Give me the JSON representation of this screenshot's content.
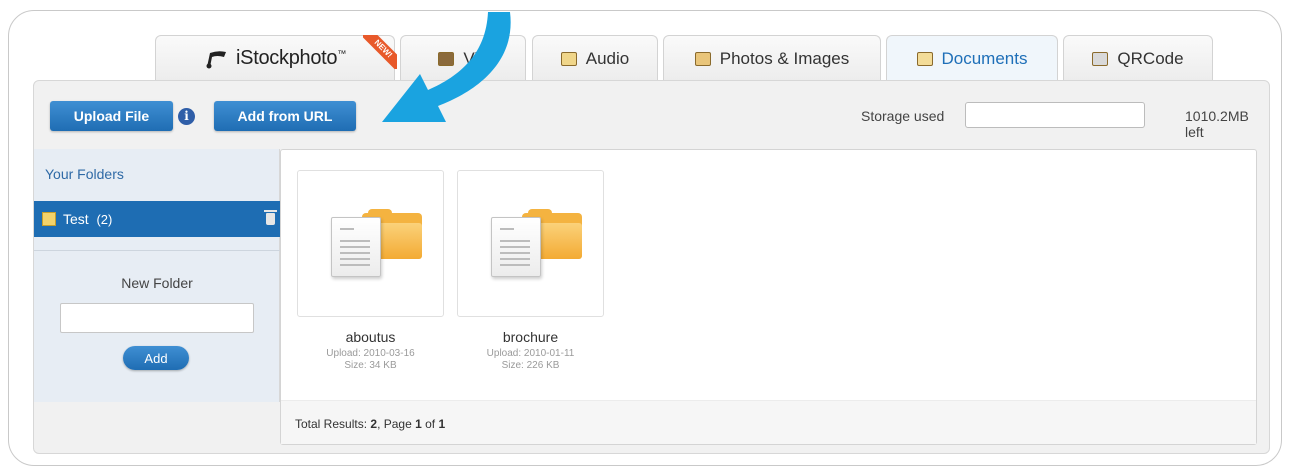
{
  "tabs": [
    {
      "label": "iStockphoto",
      "tm": "™",
      "badge": "NEW!",
      "icon": "istock-logo"
    },
    {
      "label": "Vid",
      "icon": "film-icon"
    },
    {
      "label": "Audio",
      "icon": "audio-icon"
    },
    {
      "label": "Photos & Images",
      "icon": "photo-icon"
    },
    {
      "label": "Documents",
      "icon": "document-icon",
      "active": true
    },
    {
      "label": "QRCode",
      "icon": "qrcode-icon"
    }
  ],
  "toolbar": {
    "upload_label": "Upload File",
    "info_symbol": "i",
    "add_url_label": "Add from URL",
    "storage_label": "Storage used",
    "storage_left": "1010.2MB left"
  },
  "sidebar": {
    "title": "Your Folders",
    "folder": {
      "name": "Test",
      "count": "(2)"
    },
    "new_folder_label": "New Folder",
    "add_label": "Add"
  },
  "files": [
    {
      "name": "aboutus",
      "upload": "Upload: 2010-03-16",
      "size": "Size: 34 KB"
    },
    {
      "name": "brochure",
      "upload": "Upload: 2010-01-11",
      "size": "Size: 226 KB"
    }
  ],
  "footer": {
    "prefix": "Total Results: ",
    "total": "2",
    "page_prefix": ", Page ",
    "page": "1",
    "of_text": " of ",
    "pages": "1"
  },
  "colors": {
    "accent": "#1e6db3",
    "arrow": "#1aa3e0",
    "badge": "#e8592a"
  }
}
